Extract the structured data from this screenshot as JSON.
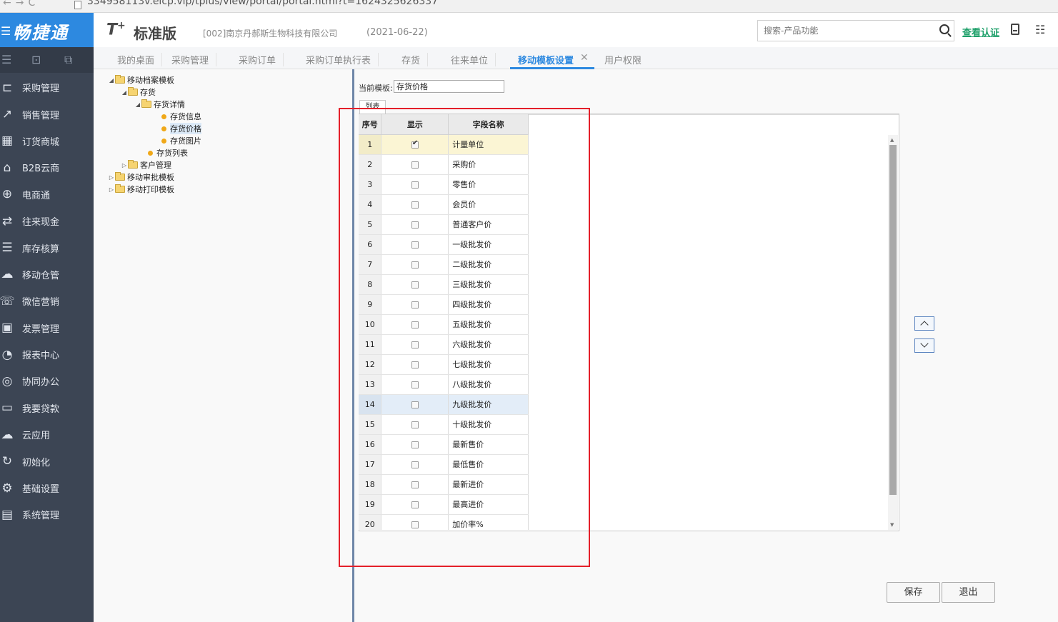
{
  "browser": {
    "url": "334958113v.eicp.vip/tplus/view/portal/portal.html?t=1624325626337"
  },
  "brand": {
    "name": "畅捷通"
  },
  "sidebar": {
    "items": [
      {
        "label": "采购管理",
        "icon": "cart-icon",
        "glyph": "⊏"
      },
      {
        "label": "销售管理",
        "icon": "chart-icon",
        "glyph": "↗"
      },
      {
        "label": "订货商城",
        "icon": "store-icon",
        "glyph": "▦"
      },
      {
        "label": "B2B云商",
        "icon": "bag-icon",
        "glyph": "⌂"
      },
      {
        "label": "电商通",
        "icon": "globe-icon",
        "glyph": "⊕"
      },
      {
        "label": "往来现金",
        "icon": "exchange-icon",
        "glyph": "⇄"
      },
      {
        "label": "库存核算",
        "icon": "warehouse-icon",
        "glyph": "☰"
      },
      {
        "label": "移动仓管",
        "icon": "mobile-warehouse-icon",
        "glyph": "☁"
      },
      {
        "label": "微信营销",
        "icon": "wechat-icon",
        "glyph": "☏"
      },
      {
        "label": "发票管理",
        "icon": "invoice-icon",
        "glyph": "▣"
      },
      {
        "label": "报表中心",
        "icon": "pie-chart-icon",
        "glyph": "◔"
      },
      {
        "label": "协同办公",
        "icon": "collaboration-icon",
        "glyph": "◎"
      },
      {
        "label": "我要贷款",
        "icon": "money-icon",
        "glyph": "▭"
      },
      {
        "label": "云应用",
        "icon": "cloud-icon",
        "glyph": "☁"
      },
      {
        "label": "初始化",
        "icon": "refresh-icon",
        "glyph": "↻"
      },
      {
        "label": "基础设置",
        "icon": "settings-icon",
        "glyph": "⚙"
      },
      {
        "label": "系统管理",
        "icon": "monitor-icon",
        "glyph": "▤"
      }
    ]
  },
  "header": {
    "logo": "T",
    "logo_sup": "+",
    "edition": "标准版",
    "company": "[002]南京丹郝斯生物科技有限公司",
    "date": "(2021-06-22)",
    "search_placeholder": "搜索-产品功能",
    "verify_link": "查看认证"
  },
  "tabs": [
    {
      "label": "我的桌面"
    },
    {
      "label": "采购管理"
    },
    {
      "label": "采购订单"
    },
    {
      "label": "采购订单执行表"
    },
    {
      "label": "存货"
    },
    {
      "label": "往来单位"
    },
    {
      "label": "移动模板设置",
      "active": true
    },
    {
      "label": "用户权限"
    }
  ],
  "tree": {
    "root1": "移动档案模板",
    "n_inventory": "存货",
    "n_inventory_detail": "存货详情",
    "n_inventory_info": "存货信息",
    "n_inventory_price": "存货价格",
    "n_inventory_image": "存货图片",
    "n_inventory_list": "存货列表",
    "n_customer": "客户管理",
    "root2": "移动审批模板",
    "root3": "移动打印模板"
  },
  "panel": {
    "template_label": "当前模板:",
    "template_value": "存货价格",
    "list_tab": "列表",
    "col_seq": "序号",
    "col_show": "显示",
    "col_field": "字段名称",
    "rows": [
      {
        "seq": "1",
        "checked": true,
        "name": "计量单位"
      },
      {
        "seq": "2",
        "checked": false,
        "name": "采购价"
      },
      {
        "seq": "3",
        "checked": false,
        "name": "零售价"
      },
      {
        "seq": "4",
        "checked": false,
        "name": "会员价"
      },
      {
        "seq": "5",
        "checked": false,
        "name": "普通客户价"
      },
      {
        "seq": "6",
        "checked": false,
        "name": "一级批发价"
      },
      {
        "seq": "7",
        "checked": false,
        "name": "二级批发价"
      },
      {
        "seq": "8",
        "checked": false,
        "name": "三级批发价"
      },
      {
        "seq": "9",
        "checked": false,
        "name": "四级批发价"
      },
      {
        "seq": "10",
        "checked": false,
        "name": "五级批发价"
      },
      {
        "seq": "11",
        "checked": false,
        "name": "六级批发价"
      },
      {
        "seq": "12",
        "checked": false,
        "name": "七级批发价"
      },
      {
        "seq": "13",
        "checked": false,
        "name": "八级批发价"
      },
      {
        "seq": "14",
        "checked": false,
        "name": "九级批发价"
      },
      {
        "seq": "15",
        "checked": false,
        "name": "十级批发价"
      },
      {
        "seq": "16",
        "checked": false,
        "name": "最新售价"
      },
      {
        "seq": "17",
        "checked": false,
        "name": "最低售价"
      },
      {
        "seq": "18",
        "checked": false,
        "name": "最新进价"
      },
      {
        "seq": "19",
        "checked": false,
        "name": "最高进价"
      },
      {
        "seq": "20",
        "checked": false,
        "name": "加价率%"
      }
    ],
    "highlight_row": "1",
    "hover_row": "14",
    "save_label": "保存",
    "exit_label": "退出"
  },
  "colors": {
    "brand_blue": "#2d89e0",
    "sidebar_bg": "#3c4554",
    "annotation_red": "#e4202a",
    "link_green": "#1ea06a"
  }
}
